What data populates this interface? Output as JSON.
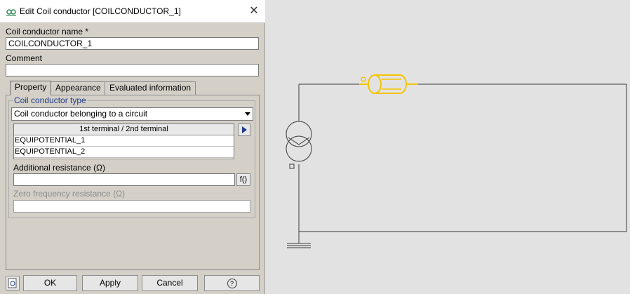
{
  "dialog": {
    "title": "Edit Coil conductor [COILCONDUCTOR_1]",
    "name_label": "Coil conductor name *",
    "name_value": "COILCONDUCTOR_1",
    "comment_label": "Comment",
    "comment_value": "",
    "tabs": [
      {
        "label": "Property",
        "active": true
      },
      {
        "label": "Appearance",
        "active": false
      },
      {
        "label": "Evaluated information",
        "active": false
      }
    ],
    "group_title": "Coil conductor  type",
    "type_selected": "Coil conductor belonging to a circuit",
    "terminal_table": {
      "header": "1st terminal / 2nd terminal",
      "rows": [
        "EQUIPOTENTIAL_1",
        "EQUIPOTENTIAL_2"
      ]
    },
    "additional_resistance_label": "Additional resistance (Ω)",
    "additional_resistance_value": "",
    "fx_label": "f()",
    "zero_freq_label": "Zero frequency resistance (Ω)",
    "zero_freq_value": "",
    "buttons": {
      "ok": "OK",
      "apply": "Apply",
      "cancel": "Cancel",
      "help": "?"
    }
  },
  "colors": {
    "accent_blue": "#1f3a8a",
    "coil_yellow": "#f5c400",
    "circuit_line": "#3a3a3a",
    "canvas_bg": "#e2e2e2"
  }
}
